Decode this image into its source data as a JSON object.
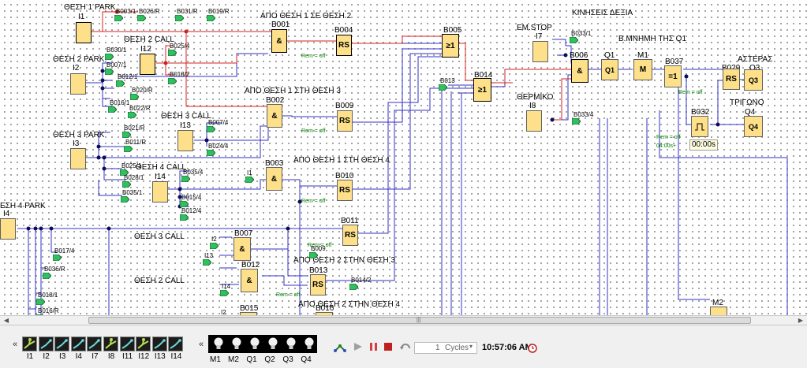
{
  "canvas": {
    "headers": [
      "ΑΠΟ ΘΕΣΗ 1 ΣΕ ΘΕΣΗ 2",
      "ΑΠΟ ΘΕΣΗ 1 ΣΤΗ ΘΕΣΗ 3",
      "ΑΠΟ ΘΕΣΗ 1 ΣΤΗ ΘΕΣΗ 4",
      "ΑΠΟ ΘΕΣΗ 2 ΣΤΗΝ ΘΕΣΗ 3",
      "ΑΠΟ ΘΕΣΗ 2 ΣΤΗΝ ΘΕΣΗ 4",
      "ΚΙΝΗΣΕΙΣ ΔΕΞΙΑ",
      "Β.ΜΝΗΜΗ ΤΗΣ Q1",
      "ΑΣΤΕΡΑΣ",
      "ΤΡΙΓΩΝΟ",
      "ΕΜ.STOP",
      "ΘΕΡΜΙΚΟ"
    ],
    "input_labels": [
      "ΘΕΣΗ 1 PARK",
      "ΘΕΣΗ 2 CALL",
      "ΘΕΣΗ 2 PARK",
      "ΘΕΣΗ 3 CALL",
      "ΘΕΣΗ 3 PARK",
      "ΘΕΣΗ 4 CALL",
      "ΕΣΗ 4 PARK",
      "ΘΕΣΗ 3 CALL",
      "ΘΕΣΗ 2 CALL"
    ],
    "inputs": [
      "I1",
      "I12",
      "I2",
      "I13",
      "I3",
      "I14",
      "I4",
      "I7",
      "I8"
    ],
    "outputs": [
      "Q1",
      "Q3",
      "Q4"
    ],
    "blocks": [
      {
        "id": "B001",
        "sym": "&"
      },
      {
        "id": "B004",
        "sym": "RS"
      },
      {
        "id": "B005",
        "sym": "≥1"
      },
      {
        "id": "B014",
        "sym": "≥1"
      },
      {
        "id": "B002",
        "sym": "&"
      },
      {
        "id": "B009",
        "sym": "RS"
      },
      {
        "id": "B003",
        "sym": "&"
      },
      {
        "id": "B010",
        "sym": "RS"
      },
      {
        "id": "B011",
        "sym": "RS"
      },
      {
        "id": "B007",
        "sym": "&"
      },
      {
        "id": "B012",
        "sym": "&"
      },
      {
        "id": "B013",
        "sym": "RS"
      },
      {
        "id": "B006",
        "sym": "&"
      },
      {
        "id": "M1",
        "sym": "M"
      },
      {
        "id": "B037",
        "sym": "=1"
      },
      {
        "id": "B029",
        "sym": "RS"
      },
      {
        "id": "B032",
        "sym": ""
      },
      {
        "id": "B015",
        "sym": ""
      },
      {
        "id": "B016",
        "sym": ""
      },
      {
        "id": "M2",
        "sym": ""
      }
    ],
    "flags": [
      "B003/1",
      "B026/R",
      "B031/R",
      "B019/R",
      "B025/4",
      "B018/2",
      "B030/1",
      "B007/1",
      "B012/1",
      "B020/R",
      "B016/1",
      "B022/R",
      "B021/R",
      "B011/R",
      "B025/1",
      "B028/1",
      "B035/1",
      "B007/4",
      "B024/4",
      "B035/4",
      "B015/4",
      "B012/4",
      "B017/4",
      "B036/R",
      "B018/1",
      "B016/R",
      "B033/1",
      "B033/4",
      "B013",
      "B014/2",
      "I1",
      "I2",
      "I13",
      "I14",
      "I2",
      "B009"
    ],
    "rem_off": "Rem = off",
    "timer_value": "00:00s",
    "timer_param": "04:00s+"
  },
  "toolbar": {
    "nav_prev": "«",
    "input_tiles": [
      "I1",
      "I2",
      "I3",
      "I4",
      "I7",
      "I8",
      "I11",
      "I12",
      "I13",
      "I14"
    ],
    "output_nav_prev": "«",
    "output_bulbs": [
      "M1",
      "M2",
      "Q1",
      "Q2",
      "Q3",
      "Q4"
    ],
    "cycles_value": "1",
    "cycles_unit": "Cycles",
    "clock": "10:57:06 AM",
    "scroll_grip": "|||"
  },
  "colors": {
    "wire_blue": "#3030c8",
    "wire_red": "#d42020",
    "block_fill": "#fde089",
    "flag_fill": "#30c060",
    "rem_green": "#008000"
  }
}
